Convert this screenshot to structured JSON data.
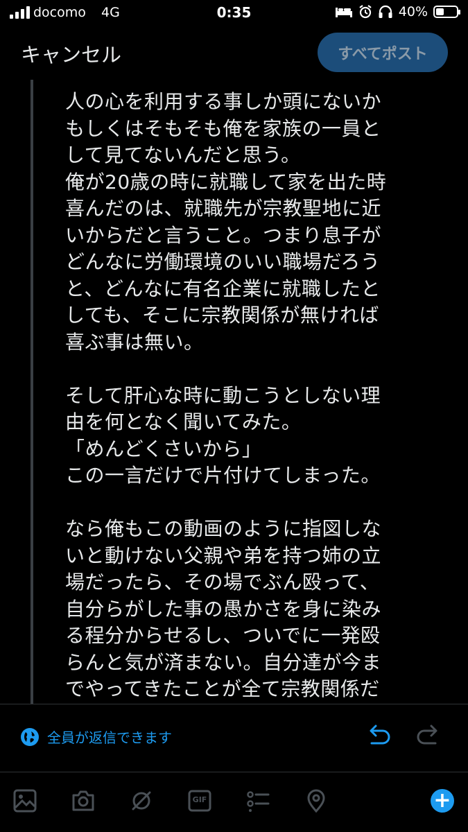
{
  "status_bar": {
    "carrier": "docomo",
    "network": "4G",
    "time": "0:35",
    "battery_text": "40%",
    "battery_level": 0.4
  },
  "header": {
    "cancel_label": "キャンセル",
    "post_all_label": "すべてポスト"
  },
  "tweet": {
    "paragraphs": [
      "人の心を利用する事しか頭にないか\nもしくはそもそも俺を家族の一員と\nして見てないんだと思う。\n俺が20歳の時に就職して家を出た時\n喜んだのは、就職先が宗教聖地に近\nいからだと言うこと。つまり息子が\nどんなに労働環境のいい職場だろう\nと、どんなに有名企業に就職したと\nしても、そこに宗教関係が無ければ\n喜ぶ事は無い。",
      "そして肝心な時に動こうとしない理\n由を何となく聞いてみた。\n「めんどくさいから」\nこの一言だけで片付けてしまった。",
      "なら俺もこの動画のように指図しな\nいと動けない父親や弟を持つ姉の立\n場だったら、その場でぶん殴って、\n自分らがした事の愚かさを身に染み\nる程分からせるし、ついでに一発殴\nらんと気が済まない。自分達が今ま\nでやってきたことが全て宗教関係だ"
    ]
  },
  "reply_settings": {
    "label": "全員が返信できます"
  },
  "toolbar": {
    "icons": [
      "image-icon",
      "camera-icon",
      "gif-icon",
      "poll-icon",
      "location-icon"
    ],
    "gif_text": "GIF",
    "add_label": "+"
  },
  "colors": {
    "accent": "#1d9bf0",
    "post_button_bg": "#1c4d7a",
    "icon_dim": "#4a5056"
  }
}
